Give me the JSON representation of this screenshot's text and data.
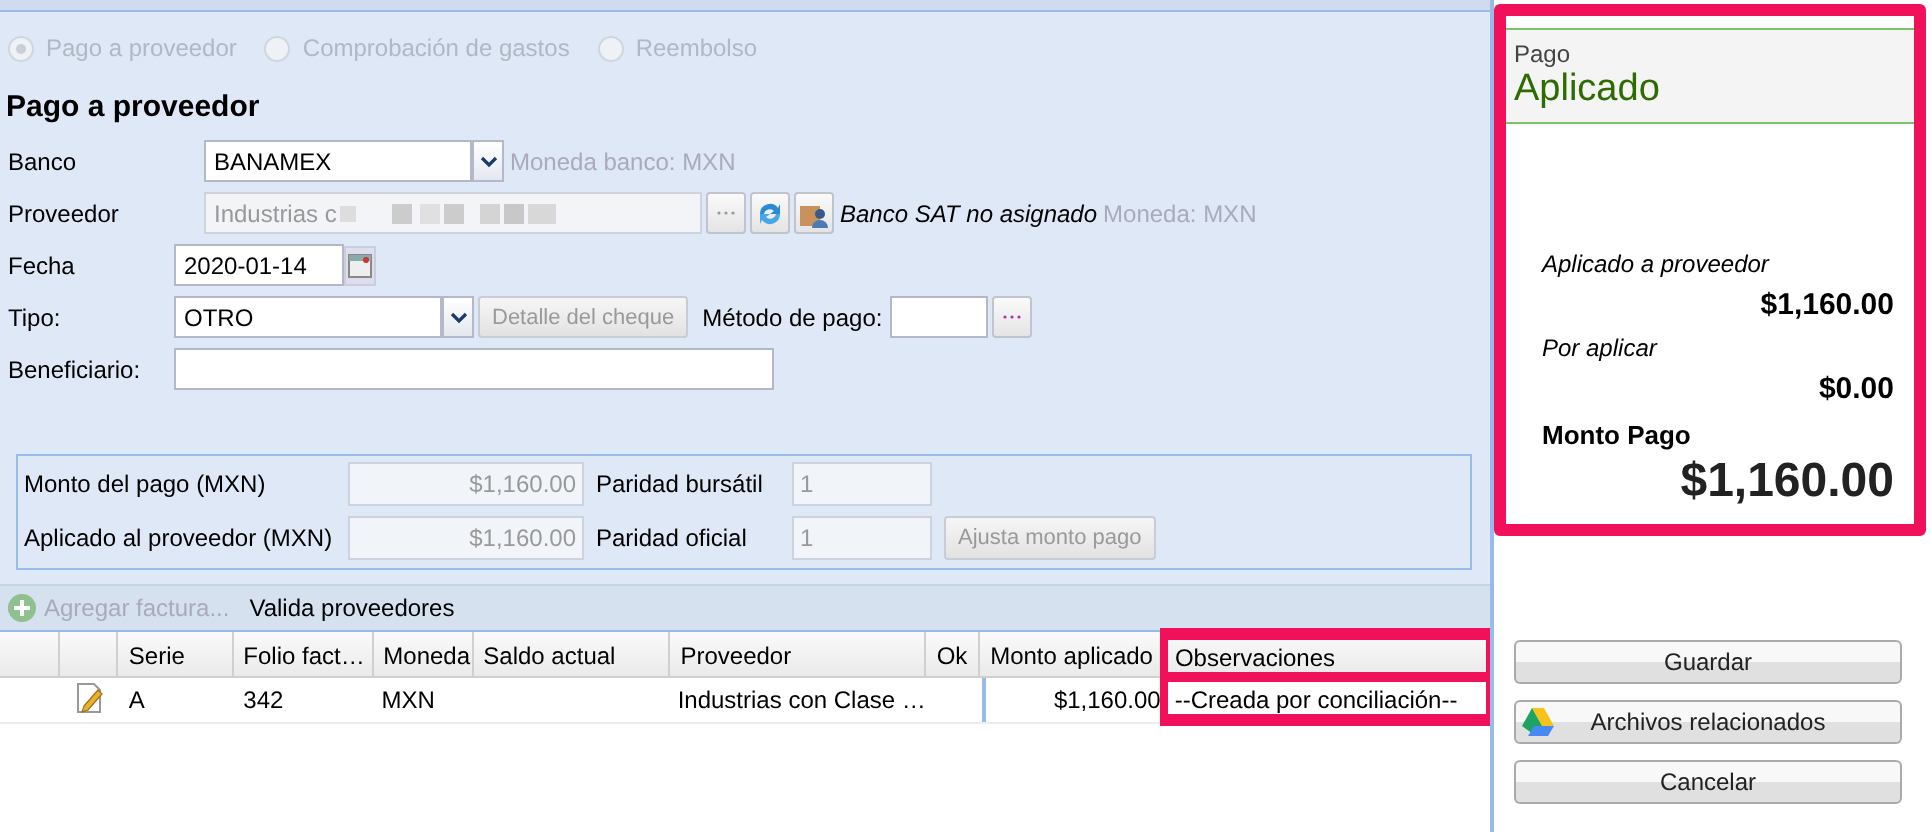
{
  "payment_types": [
    {
      "label": "Pago a proveedor",
      "selected": true
    },
    {
      "label": "Comprobación de gastos",
      "selected": false
    },
    {
      "label": "Reembolso",
      "selected": false
    }
  ],
  "form": {
    "title": "Pago a proveedor",
    "banco": {
      "label": "Banco",
      "value": "BANAMEX",
      "currency_note": "Moneda banco: MXN"
    },
    "proveedor": {
      "label": "Proveedor",
      "value": "Industrias c",
      "disabled": true,
      "redacted": true,
      "sat_note": "Banco SAT no asignado",
      "currency_note": "Moneda: MXN"
    },
    "fecha": {
      "label": "Fecha",
      "value": "2020-01-14"
    },
    "tipo": {
      "label": "Tipo:",
      "value": "OTRO",
      "detail_button": "Detalle del cheque",
      "method_label": "Método de pago:"
    },
    "beneficiario": {
      "label": "Beneficiario:"
    }
  },
  "amounts": {
    "monto_label": "Monto del pago (MXN)",
    "monto_value": "$1,160.00",
    "bursatil_label": "Paridad bursátil",
    "bursatil_value": "1",
    "aplicado_label": "Aplicado al proveedor (MXN)",
    "aplicado_value": "$1,160.00",
    "oficial_label": "Paridad oficial",
    "oficial_value": "1",
    "adjust_button": "Ajusta monto pago"
  },
  "toolbar": [
    {
      "kind": "add",
      "label": "Agregar factura...",
      "disabled": true
    },
    {
      "kind": "plain",
      "label": "Valida proveedores",
      "disabled": false
    }
  ],
  "table": {
    "columns": [
      {
        "label": "Serie",
        "highlighted": false
      },
      {
        "label": "Folio fact…",
        "highlighted": false
      },
      {
        "label": "Moneda",
        "highlighted": false
      },
      {
        "label": "Saldo actual",
        "highlighted": false
      },
      {
        "label": "Proveedor",
        "highlighted": false
      },
      {
        "label": "Ok",
        "highlighted": false
      },
      {
        "label": "Monto aplicado",
        "highlighted": false
      },
      {
        "label": "Observaciones",
        "highlighted": true
      }
    ],
    "rows": [
      {
        "serie": "A",
        "folio": "342",
        "moneda": "MXN",
        "proveedor": "Industrias con Clase …",
        "monto": "$1,160.00",
        "observaciones": "--Creada por conciliación--"
      }
    ]
  },
  "status_panel": {
    "label": "Pago",
    "status": "Aplicado",
    "highlighted": true,
    "applied_label": "Aplicado a proveedor",
    "applied_value": "$1,160.00",
    "pending_label": "Por aplicar",
    "pending_value": "$0.00",
    "total_label": "Monto Pago",
    "total_value": "$1,160.00"
  },
  "buttons": [
    {
      "kind": "plain",
      "label": "Guardar"
    },
    {
      "kind": "drive",
      "label": "Archivos relacionados"
    },
    {
      "kind": "plain",
      "label": "Cancelar"
    }
  ]
}
